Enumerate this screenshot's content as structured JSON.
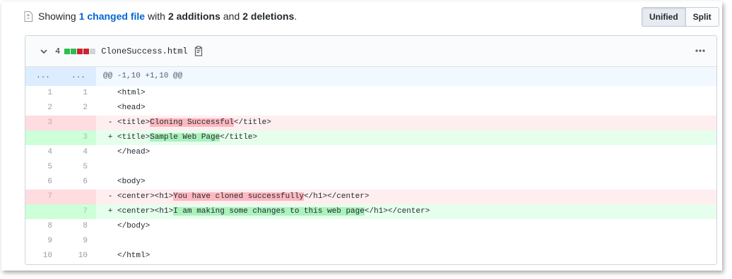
{
  "summary": {
    "prefix": "Showing",
    "changed_files": "1 changed file",
    "with": "with",
    "additions": "2 additions",
    "and": "and",
    "deletions": "2 deletions",
    "period": "."
  },
  "view_toggle": {
    "unified_label": "Unified",
    "split_label": "Split",
    "selected": "Unified"
  },
  "file": {
    "change_count": "4",
    "filename": "CloneSuccess.html",
    "diffstat": [
      "add",
      "add",
      "del",
      "del",
      "neutral"
    ],
    "colors": {
      "add": "#2cbe4e",
      "del": "#cb2431",
      "neutral": "#d1d5da"
    }
  },
  "hunk": {
    "old_expander": "...",
    "new_expander": "...",
    "header": "@@ -1,10 +1,10 @@"
  },
  "lines": [
    {
      "type": "ctx",
      "old": "1",
      "new": "1",
      "sign": "",
      "pre": "<html>",
      "hl": "",
      "post": ""
    },
    {
      "type": "ctx",
      "old": "2",
      "new": "2",
      "sign": "",
      "pre": "<head>",
      "hl": "",
      "post": ""
    },
    {
      "type": "del",
      "old": "3",
      "new": "",
      "sign": "-",
      "pre": "<title>",
      "hl": "Cloning Successful",
      "post": "</title>"
    },
    {
      "type": "add",
      "old": "",
      "new": "3",
      "sign": "+",
      "pre": "<title>",
      "hl": "Sample Web Page",
      "post": "</title>"
    },
    {
      "type": "ctx",
      "old": "4",
      "new": "4",
      "sign": "",
      "pre": "</head>",
      "hl": "",
      "post": ""
    },
    {
      "type": "ctx",
      "old": "5",
      "new": "5",
      "sign": "",
      "pre": "",
      "hl": "",
      "post": ""
    },
    {
      "type": "ctx",
      "old": "6",
      "new": "6",
      "sign": "",
      "pre": "<body>",
      "hl": "",
      "post": ""
    },
    {
      "type": "del",
      "old": "7",
      "new": "",
      "sign": "-",
      "pre": "<center><h1>",
      "hl": "You have cloned successfully",
      "post": "</h1></center>"
    },
    {
      "type": "add",
      "old": "",
      "new": "7",
      "sign": "+",
      "pre": "<center><h1>",
      "hl": "I am making some changes to this web page",
      "post": "</h1></center>"
    },
    {
      "type": "ctx",
      "old": "8",
      "new": "8",
      "sign": "",
      "pre": "</body>",
      "hl": "",
      "post": ""
    },
    {
      "type": "ctx",
      "old": "9",
      "new": "9",
      "sign": "",
      "pre": "",
      "hl": "",
      "post": ""
    },
    {
      "type": "ctx",
      "old": "10",
      "new": "10",
      "sign": "",
      "pre": "</html>",
      "hl": "",
      "post": ""
    }
  ],
  "icons": {
    "summary": "file-diff-icon",
    "collapse": "chevron-down-icon",
    "copy": "clippy-icon",
    "menu": "kebab-horizontal-icon"
  }
}
